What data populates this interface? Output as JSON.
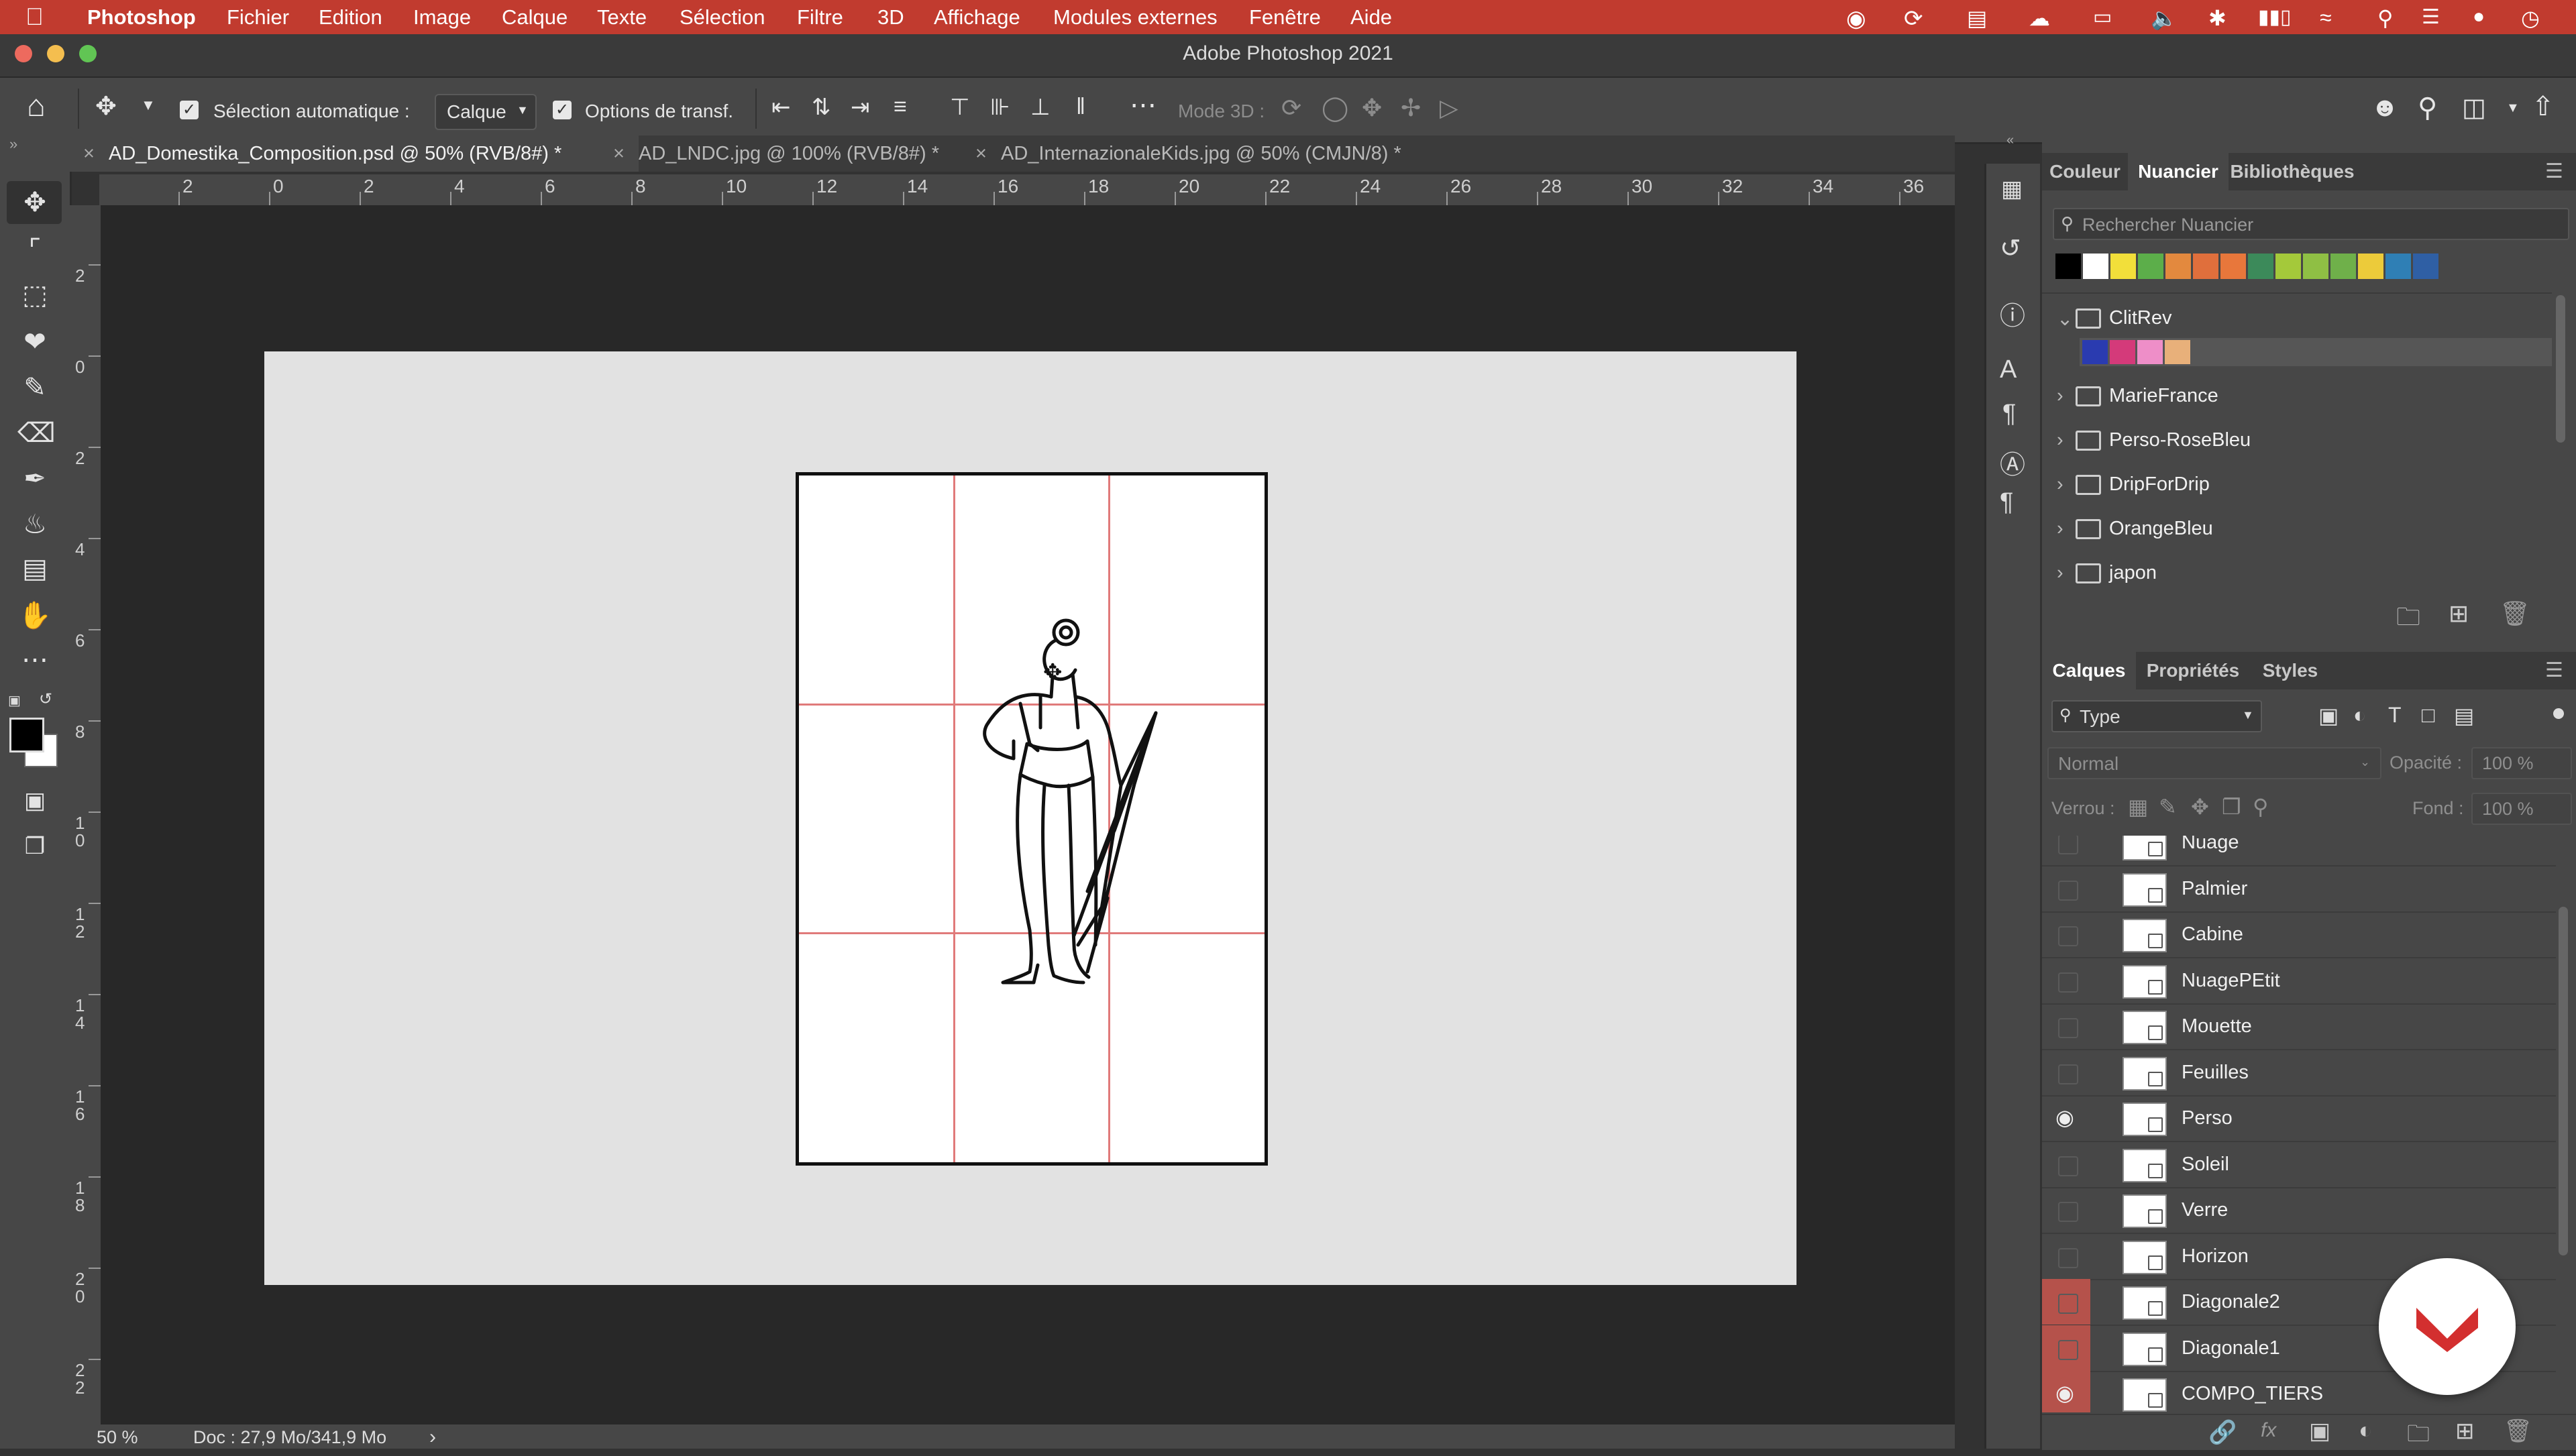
{
  "menubar": {
    "app": "Photoshop",
    "items": [
      "Fichier",
      "Edition",
      "Image",
      "Calque",
      "Texte",
      "Sélection",
      "Filtre",
      "3D",
      "Affichage",
      "Modules externes",
      "Fenêtre",
      "Aide"
    ]
  },
  "window": {
    "title": "Adobe Photoshop 2021"
  },
  "options": {
    "auto_select_label": "Sélection automatique :",
    "auto_select_value": "Calque",
    "transform_label": "Options de transf.",
    "mode3d_label": "Mode 3D :"
  },
  "tabs": [
    {
      "label": "AD_Domestika_Composition.psd @ 50% (RVB/8#) *",
      "active": true
    },
    {
      "label": "AD_LNDC.jpg @ 100% (RVB/8#) *",
      "active": false
    },
    {
      "label": "AD_InternazionaleKids.jpg @ 50% (CMJN/8) *",
      "active": false
    }
  ],
  "ruler": {
    "h_ticks": [
      "2",
      "0",
      "2",
      "4",
      "6",
      "8",
      "10",
      "12",
      "14",
      "16",
      "18",
      "20",
      "22",
      "24",
      "26",
      "28",
      "30",
      "32",
      "34",
      "36"
    ],
    "v_ticks": [
      "2",
      "0",
      "2",
      "4",
      "6",
      "8",
      "1\n0",
      "1\n2",
      "1\n4",
      "1\n6",
      "1\n8",
      "2\n0",
      "2\n2"
    ]
  },
  "status": {
    "zoom": "50 %",
    "doc": "Doc : 27,9 Mo/341,9 Mo",
    "arrow": "›"
  },
  "swatch_panel": {
    "tabs": [
      "Couleur",
      "Nuancier",
      "Bibliothèques"
    ],
    "active_tab": "Nuancier",
    "search_placeholder": "Rechercher Nuancier",
    "recent_colors": [
      "#000000",
      "#ffffff",
      "#f2df3a",
      "#5cae4a",
      "#e3893e",
      "#e06f3c",
      "#e8773b",
      "#3c8a5a",
      "#a4c93a",
      "#8fbf44",
      "#6fb04a",
      "#eccb3a",
      "#2f7fb5",
      "#2f5fa4"
    ],
    "groups": [
      {
        "name": "ClitRev",
        "expanded": true,
        "colors": [
          "#2a3bb0",
          "#d43a7a",
          "#ee8ec8",
          "#e8b07a"
        ]
      },
      {
        "name": "MarieFrance",
        "expanded": false
      },
      {
        "name": "Perso-RoseBleu",
        "expanded": false
      },
      {
        "name": "DripForDrip",
        "expanded": false
      },
      {
        "name": "OrangeBleu",
        "expanded": false
      },
      {
        "name": "japon",
        "expanded": false
      }
    ]
  },
  "layers_panel": {
    "tabs": [
      "Calques",
      "Propriétés",
      "Styles"
    ],
    "active_tab": "Calques",
    "filter_value": "Type",
    "blend_mode": "Normal",
    "opacity_label": "Opacité :",
    "opacity_value": "100 %",
    "lock_label": "Verrou :",
    "fill_label": "Fond :",
    "fill_value": "100 %",
    "layers": [
      {
        "name": "Nuage",
        "visible": false
      },
      {
        "name": "Palmier",
        "visible": false
      },
      {
        "name": "Cabine",
        "visible": false
      },
      {
        "name": "NuagePEtit",
        "visible": false
      },
      {
        "name": "Mouette",
        "visible": false
      },
      {
        "name": "Feuilles",
        "visible": false
      },
      {
        "name": "Perso",
        "visible": true
      },
      {
        "name": "Soleil",
        "visible": false
      },
      {
        "name": "Verre",
        "visible": false
      },
      {
        "name": "Horizon",
        "visible": false
      },
      {
        "name": "Diagonale2",
        "visible": false,
        "color_tag": "#b5524b"
      },
      {
        "name": "Diagonale1",
        "visible": false,
        "color_tag": "#b5524b"
      },
      {
        "name": "COMPO_TIERS",
        "visible": true,
        "color_tag": "#b5524b"
      }
    ]
  },
  "colors": {
    "menubar": "#c13b2f",
    "guide": "#e07a7a",
    "brand_badge": "#d32f2f"
  }
}
